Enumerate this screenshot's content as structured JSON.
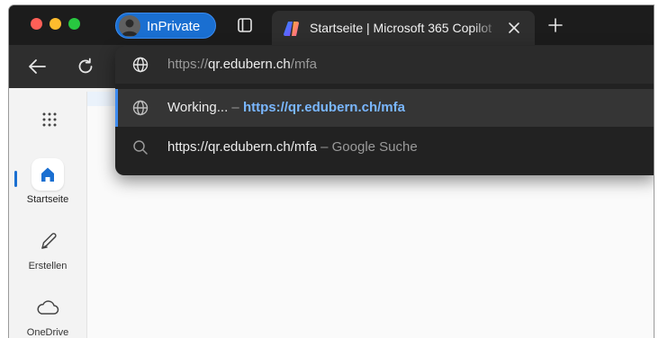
{
  "window": {
    "inprivate_label": "InPrivate"
  },
  "tab": {
    "title": "Startseite | Microsoft 365 Copilot",
    "favicon": "copilot-icon"
  },
  "omnibox": {
    "input": {
      "prefix": "https://",
      "host": "qr.edubern.ch",
      "path": "/mfa"
    },
    "suggestions": [
      {
        "icon": "globe-icon",
        "title": "Working...",
        "separator": " – ",
        "url": "https://qr.edubern.ch/mfa",
        "selected": true
      },
      {
        "icon": "search-icon",
        "query": "https://qr.edubern.ch/mfa",
        "separator": " – ",
        "engine": "Google Suche"
      }
    ]
  },
  "sidebar": {
    "items": [
      {
        "label": "Startseite",
        "icon": "home-icon",
        "active": true
      },
      {
        "label": "Erstellen",
        "icon": "pen-icon"
      },
      {
        "label": "OneDrive",
        "icon": "cloud-icon"
      }
    ]
  },
  "colors": {
    "accent": "#1a6fd1",
    "link": "#7ab7ff"
  }
}
